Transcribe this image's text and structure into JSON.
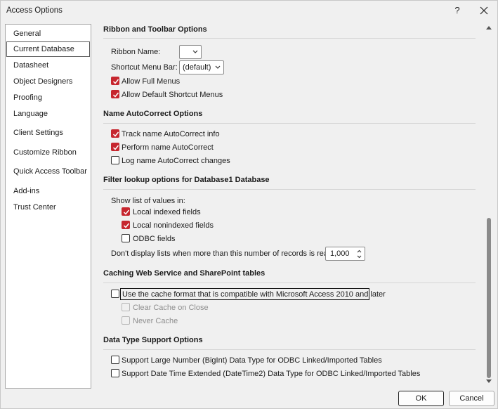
{
  "window": {
    "title": "Access Options",
    "help_label": "?"
  },
  "sidebar": {
    "items": [
      {
        "label": "General"
      },
      {
        "label": "Current Database",
        "selected": true
      },
      {
        "label": "Datasheet"
      },
      {
        "label": "Object Designers"
      },
      {
        "label": "Proofing"
      },
      {
        "label": "Language"
      },
      {
        "label": "Client Settings"
      },
      {
        "label": "Customize Ribbon"
      },
      {
        "label": "Quick Access Toolbar"
      },
      {
        "label": "Add-ins"
      },
      {
        "label": "Trust Center"
      }
    ]
  },
  "ribbon": {
    "heading": "Ribbon and Toolbar Options",
    "ribbon_name_label": "Ribbon Name:",
    "ribbon_name_value": "",
    "shortcut_menu_label": "Shortcut Menu Bar:",
    "shortcut_menu_value": "(default)",
    "allow_full_menus": {
      "label": "Allow Full Menus",
      "checked": true
    },
    "allow_default_shortcut": {
      "label": "Allow Default Shortcut Menus",
      "checked": true
    }
  },
  "autocorrect": {
    "heading": "Name AutoCorrect Options",
    "track": {
      "label": "Track name AutoCorrect info",
      "checked": true
    },
    "perform": {
      "label": "Perform name AutoCorrect",
      "checked": true
    },
    "log": {
      "label": "Log name AutoCorrect changes",
      "checked": false
    }
  },
  "filter": {
    "heading": "Filter lookup options for Database1 Database",
    "show_list_label": "Show list of values in:",
    "local_indexed": {
      "label": "Local indexed fields",
      "checked": true
    },
    "local_nonindexed": {
      "label": "Local nonindexed fields",
      "checked": true
    },
    "odbc": {
      "label": "ODBC fields",
      "checked": false
    },
    "max_records_label": "Don't display lists when more than this number of records is read:",
    "max_records_value": "1,000"
  },
  "caching": {
    "heading": "Caching Web Service and SharePoint tables",
    "cache_format": {
      "label": "Use the cache format that is compatible with Microsoft Access 2010 and later",
      "checked": false
    },
    "clear_cache": {
      "label": "Clear Cache on Close",
      "checked": false,
      "disabled": true
    },
    "never_cache": {
      "label": "Never Cache",
      "checked": false,
      "disabled": true
    }
  },
  "datatype": {
    "heading": "Data Type Support Options",
    "bigint": {
      "label": "Support Large Number (BigInt) Data Type for ODBC Linked/Imported Tables",
      "checked": false
    },
    "datetime2": {
      "label": "Support Date Time Extended (DateTime2) Data Type for ODBC Linked/Imported Tables",
      "checked": false
    }
  },
  "footer": {
    "ok_label": "OK",
    "cancel_label": "Cancel"
  },
  "colors": {
    "accent_check": "#c6262e",
    "background": "#f0f0f0"
  }
}
